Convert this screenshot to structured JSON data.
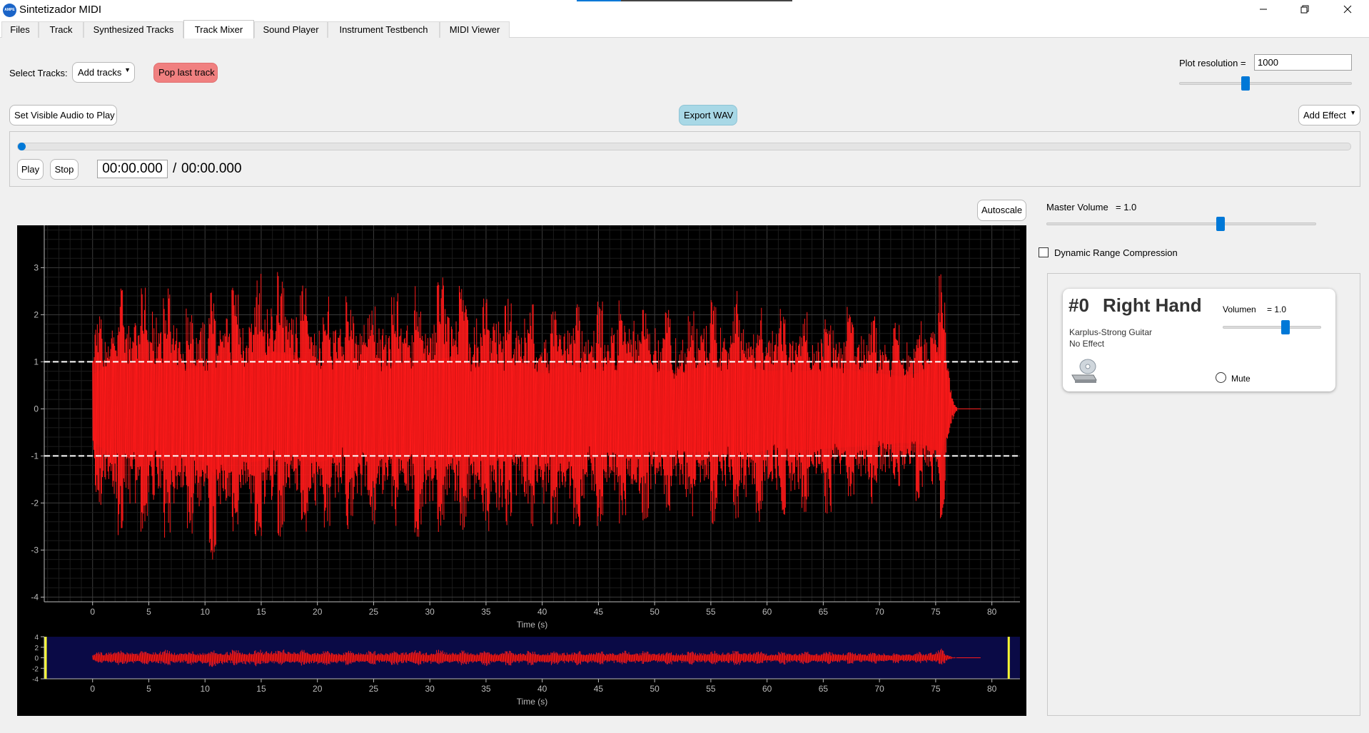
{
  "window": {
    "title": "Sintetizador MIDI",
    "icon_label": "AMPE MIDI",
    "controls": [
      "minimize-icon",
      "restore-icon",
      "close-icon"
    ]
  },
  "tabs": [
    {
      "label": "Files",
      "active": false
    },
    {
      "label": "Track",
      "active": false
    },
    {
      "label": "Synthesized Tracks",
      "active": false
    },
    {
      "label": "Track Mixer",
      "active": true
    },
    {
      "label": "Sound Player",
      "active": false
    },
    {
      "label": "Instrument Testbench",
      "active": false
    },
    {
      "label": "MIDI Viewer",
      "active": false
    }
  ],
  "toolbar": {
    "select_tracks_label": "Select Tracks:",
    "add_tracks_label": "Add tracks",
    "pop_last_track_label": "Pop last track",
    "plot_resolution_label": "Plot resolution =",
    "plot_resolution_value": "1000",
    "plot_resolution_slider": 0.38,
    "set_visible_audio_label": "Set Visible Audio to Play",
    "export_wav_label": "Export WAV",
    "add_effect_label": "Add Effect"
  },
  "player": {
    "progress": 0.0,
    "play_label": "Play",
    "stop_label": "Stop",
    "current_time": "00:00.000",
    "separator": "/",
    "total_time": "00:00.000"
  },
  "plot_controls": {
    "autoscale_label": "Autoscale"
  },
  "mixer": {
    "master_volume_label": "Master Volume",
    "master_volume_value": "= 1.0",
    "master_volume_slider": 0.65,
    "drc_label": "Dynamic Range Compression",
    "drc_checked": false
  },
  "tracks": [
    {
      "number": "#0",
      "name": "Right Hand",
      "volume_label": "Volumen",
      "volume_value": "= 1.0",
      "volume_slider": 0.65,
      "instrument": "Karplus-Strong Guitar",
      "effect": "No Effect",
      "mute_label": "Mute",
      "muted": false
    }
  ],
  "colors": {
    "waveform": "#ff1a1a",
    "plot_bg": "#000000",
    "overview_bg": "#0a0a46",
    "accent": "#0078d7",
    "range_marker": "#ffff33"
  },
  "chart_data": [
    {
      "type": "line",
      "title": "",
      "xlabel": "Time (s)",
      "ylabel": "",
      "xlim": [
        -4.3,
        82.5
      ],
      "ylim": [
        -4.1,
        3.9
      ],
      "xticks": [
        "0",
        "5",
        "10",
        "15",
        "20",
        "25",
        "30",
        "35",
        "40",
        "45",
        "50",
        "55",
        "60",
        "65",
        "70",
        "75",
        "80"
      ],
      "yticks": [
        "3",
        "2",
        "1",
        "0",
        "-1",
        "-2",
        "-3",
        "-4"
      ],
      "grid": true,
      "reference_lines": [
        1,
        -1
      ],
      "series": [
        {
          "start": 0.0,
          "end": 76.9,
          "upper": [
            [
              0,
              1.9
            ],
            [
              2,
              2.7
            ],
            [
              4,
              2.5
            ],
            [
              6,
              2.9
            ],
            [
              8,
              2.2
            ],
            [
              10,
              2.4
            ],
            [
              12,
              2.8
            ],
            [
              14,
              2.6
            ],
            [
              16,
              3.2
            ],
            [
              18,
              3.0
            ],
            [
              20,
              2.4
            ],
            [
              22,
              2.5
            ],
            [
              24,
              2.7
            ],
            [
              26,
              2.3
            ],
            [
              28,
              2.6
            ],
            [
              30,
              2.7
            ],
            [
              32,
              2.9
            ],
            [
              34,
              2.4
            ],
            [
              36,
              2.5
            ],
            [
              38,
              2.6
            ],
            [
              40,
              2.0
            ],
            [
              42,
              2.5
            ],
            [
              44,
              2.2
            ],
            [
              46,
              2.4
            ],
            [
              48,
              2.5
            ],
            [
              50,
              2.3
            ],
            [
              52,
              2.0
            ],
            [
              54,
              2.3
            ],
            [
              56,
              2.4
            ],
            [
              58,
              2.6
            ],
            [
              60,
              2.1
            ],
            [
              62,
              2.2
            ],
            [
              64,
              2.1
            ],
            [
              66,
              2.4
            ],
            [
              68,
              2.1
            ],
            [
              70,
              2.0
            ],
            [
              72,
              1.8
            ],
            [
              74,
              2.1
            ],
            [
              75.5,
              3.2
            ],
            [
              76.5,
              0.3
            ],
            [
              77,
              0.0
            ]
          ],
          "lower": [
            [
              0,
              -1.8
            ],
            [
              2,
              -2.7
            ],
            [
              4,
              -2.6
            ],
            [
              6,
              -2.8
            ],
            [
              8,
              -2.5
            ],
            [
              10,
              -3.0
            ],
            [
              11,
              -3.8
            ],
            [
              12,
              -2.7
            ],
            [
              14,
              -3.0
            ],
            [
              16,
              -2.8
            ],
            [
              18,
              -2.6
            ],
            [
              20,
              -3.0
            ],
            [
              22,
              -2.7
            ],
            [
              24,
              -2.6
            ],
            [
              26,
              -2.5
            ],
            [
              28,
              -2.6
            ],
            [
              30,
              -2.9
            ],
            [
              32,
              -2.7
            ],
            [
              34,
              -2.8
            ],
            [
              36,
              -2.9
            ],
            [
              38,
              -2.5
            ],
            [
              40,
              -2.7
            ],
            [
              42,
              -2.6
            ],
            [
              44,
              -2.6
            ],
            [
              46,
              -2.4
            ],
            [
              48,
              -2.6
            ],
            [
              50,
              -2.3
            ],
            [
              52,
              -2.5
            ],
            [
              54,
              -2.4
            ],
            [
              56,
              -2.5
            ],
            [
              58,
              -2.6
            ],
            [
              60,
              -2.3
            ],
            [
              62,
              -2.3
            ],
            [
              64,
              -2.3
            ],
            [
              66,
              -2.2
            ],
            [
              68,
              -2.1
            ],
            [
              70,
              -2.0
            ],
            [
              72,
              -1.9
            ],
            [
              74,
              -2.0
            ],
            [
              75.5,
              -2.5
            ],
            [
              76.5,
              -0.3
            ],
            [
              77,
              0.0
            ]
          ]
        }
      ]
    },
    {
      "type": "line",
      "title": "",
      "xlabel": "Time (s)",
      "xlim": [
        -4.3,
        82.5
      ],
      "ylim": [
        -4,
        4
      ],
      "xticks": [
        "0",
        "5",
        "10",
        "15",
        "20",
        "25",
        "30",
        "35",
        "40",
        "45",
        "50",
        "55",
        "60",
        "65",
        "70",
        "75",
        "80"
      ],
      "yticks": [
        "4",
        "2",
        "0",
        "-2",
        "-4"
      ],
      "visible_region": [
        -4.3,
        81.5
      ]
    }
  ]
}
